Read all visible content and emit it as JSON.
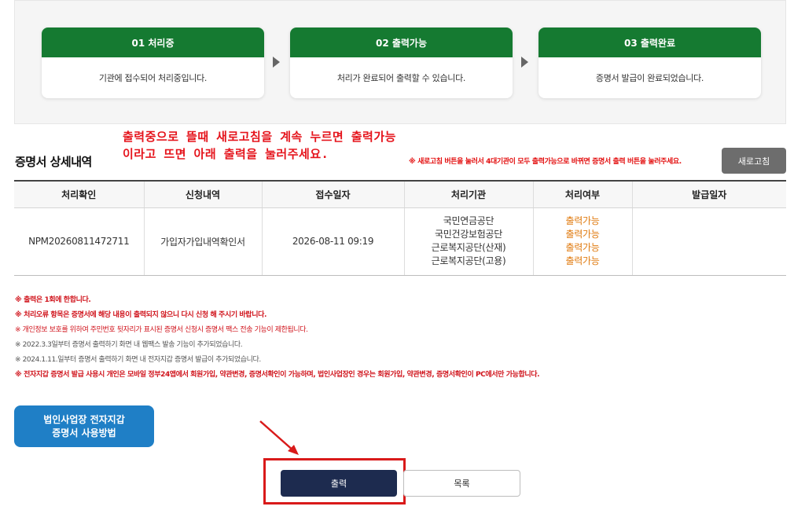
{
  "steps": [
    {
      "title": "01 처리중",
      "desc": "기관에 접수되어 처리중입니다."
    },
    {
      "title": "02 출력가능",
      "desc": "처리가 완료되어 출력할 수 있습니다."
    },
    {
      "title": "03 출력완료",
      "desc": "증명서 발급이 완료되었습니다."
    }
  ],
  "annotation": {
    "line1": "출력중으로 뜰때 새로고침을 계속 누르면 출력가능",
    "line2": "이라고 뜨면 아래 출력을 눌러주세요."
  },
  "section": {
    "title": "증명서 상세내역",
    "refresh_note": "※ 새로고침 버튼을 눌러서 4대기관이 모두 출력가능으로 바뀌면 증명서 출력 버튼을 눌러주세요.",
    "refresh_label": "새로고침"
  },
  "table": {
    "headers": [
      "처리확인",
      "신청내역",
      "접수일자",
      "처리기관",
      "처리여부",
      "발급일자"
    ],
    "row": {
      "id": "NPM20260811472711",
      "request": "가입자가입내역확인서",
      "date": "2026-08-11 09:19",
      "agencies": [
        "국민연금공단",
        "국민건강보험공단",
        "근로복지공단(산재)",
        "근로복지공단(고용)"
      ],
      "statuses": [
        "출력가능",
        "출력가능",
        "출력가능",
        "출력가능"
      ],
      "issue_date": ""
    }
  },
  "notes": [
    "※ 출력은 1회에 한합니다.",
    "※ 처리오류 항목은 증명서에 해당 내용이 출력되지 않으니 다시 신청 해 주시기 바랍니다.",
    "※ 개인정보 보호를 위하여 주민번호 뒷자리가 표시된 증명서 신청시 증명서 팩스 전송 기능이 제한됩니다.",
    "※ 2022.3.3일부터 증명서 출력하기 화면 내 웹팩스 발송 기능이 추가되었습니다.",
    "※ 2024.1.11.일부터 증명서 출력하기 화면 내 전자지갑 증명서 발급이 추가되었습니다.",
    "※ 전자지갑 증명서 발급 사용시 개인은 모바일 정부24앱에서 회원가입, 약관변경, 증명서확인이 가능하며, 법인사업장인 경우는 회원가입, 약관변경, 증명서확인이 PC에서만 가능합니다."
  ],
  "wallet_button": {
    "line1": "법인사업장 전자지갑",
    "line2": "증명서 사용방법"
  },
  "actions": {
    "print_label": "출력",
    "list_label": "목록"
  },
  "colors": {
    "green": "#157a31",
    "navy": "#1d2b4f",
    "blue": "#1f7fc6",
    "red": "#d0131b",
    "orange": "#e07b10"
  }
}
